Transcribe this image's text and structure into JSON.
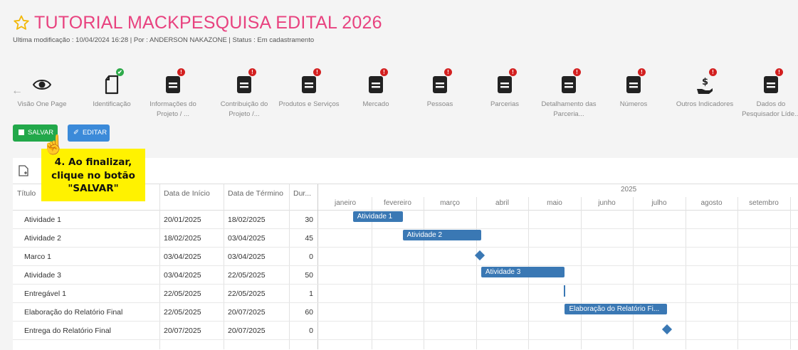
{
  "header": {
    "title": "TUTORIAL MACKPESQUISA EDITAL 2026",
    "meta": "Ultima modificação : 10/04/2024 16:28 | Por : ANDERSON NAKAZONE | Status : Em cadastramento"
  },
  "steps": [
    {
      "icon": "eye-icon",
      "label1": "Visão One Page",
      "label2": "",
      "status": "none"
    },
    {
      "icon": "document-icon",
      "label1": "Identificação",
      "label2": "",
      "status": "ok"
    },
    {
      "icon": "form-icon",
      "label1": "Informações do",
      "label2": "Projeto / ...",
      "status": "error"
    },
    {
      "icon": "form-icon",
      "label1": "Contribuição do",
      "label2": "Projeto /...",
      "status": "error"
    },
    {
      "icon": "form-icon",
      "label1": "Produtos e Serviços",
      "label2": "",
      "status": "error"
    },
    {
      "icon": "form-icon",
      "label1": "Mercado",
      "label2": "",
      "status": "error"
    },
    {
      "icon": "form-icon",
      "label1": "Pessoas",
      "label2": "",
      "status": "error"
    },
    {
      "icon": "form-icon",
      "label1": "Parcerias",
      "label2": "",
      "status": "error"
    },
    {
      "icon": "form-icon",
      "label1": "Detalhamento das",
      "label2": "Parceria...",
      "status": "error"
    },
    {
      "icon": "form-icon",
      "label1": "Números",
      "label2": "",
      "status": "error"
    },
    {
      "icon": "money-hand-icon",
      "label1": "Outros Indicadores",
      "label2": "",
      "status": "error"
    },
    {
      "icon": "form-icon",
      "label1": "Dados do",
      "label2": "Pesquisador Líde...",
      "status": "error"
    }
  ],
  "badges": {
    "ok": "✔",
    "error": "!"
  },
  "toolbar": {
    "save_label": "SALVAR",
    "edit_label": "EDITAR"
  },
  "callout": {
    "line1": "4. Ao finalizar,",
    "line2": "clique no botão",
    "line3": "\"SALVAR\""
  },
  "grid": {
    "columns": [
      "Título",
      "Data de Início",
      "Data de Término",
      "Dur..."
    ],
    "rows": [
      {
        "title": "Atividade 1",
        "start": "20/01/2025",
        "end": "18/02/2025",
        "duration": "30"
      },
      {
        "title": "Atividade 2",
        "start": "18/02/2025",
        "end": "03/04/2025",
        "duration": "45"
      },
      {
        "title": "Marco 1",
        "start": "03/04/2025",
        "end": "03/04/2025",
        "duration": "0"
      },
      {
        "title": "Atividade 3",
        "start": "03/04/2025",
        "end": "22/05/2025",
        "duration": "50"
      },
      {
        "title": "Entregável 1",
        "start": "22/05/2025",
        "end": "22/05/2025",
        "duration": "1"
      },
      {
        "title": "Elaboração do Relatório Final",
        "start": "22/05/2025",
        "end": "20/07/2025",
        "duration": "60"
      },
      {
        "title": "Entrega do Relatório Final",
        "start": "20/07/2025",
        "end": "20/07/2025",
        "duration": "0"
      }
    ]
  },
  "gantt": {
    "year": "2025",
    "months": [
      "janeiro",
      "fevereiro",
      "março",
      "abril",
      "maio",
      "junho",
      "julho",
      "agosto",
      "setembro"
    ],
    "items": [
      {
        "type": "bar",
        "label": "Atividade 1",
        "start_month": 0.65,
        "end_month": 1.6
      },
      {
        "type": "bar",
        "label": "Atividade 2",
        "start_month": 1.6,
        "end_month": 3.1
      },
      {
        "type": "milestone",
        "label": "",
        "at_month": 3.08
      },
      {
        "type": "bar",
        "label": "Atividade 3",
        "start_month": 3.1,
        "end_month": 4.7
      },
      {
        "type": "deliverable",
        "label": "",
        "at_month": 4.7
      },
      {
        "type": "bar",
        "label": "Elaboração do Relatório Fi...",
        "start_month": 4.7,
        "end_month": 6.65
      },
      {
        "type": "milestone",
        "label": "",
        "at_month": 6.65
      }
    ]
  },
  "colors": {
    "accent": "#e8427f",
    "save": "#22a84a",
    "edit": "#3b8ad9",
    "bar": "#3a78b4",
    "star": "#f2b705"
  }
}
